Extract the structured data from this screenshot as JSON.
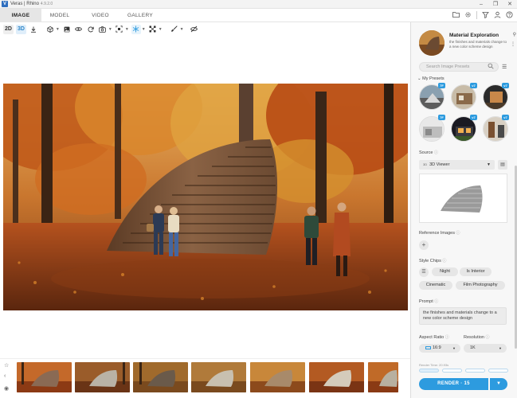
{
  "window": {
    "app_logo": "V",
    "title": "Veras | Rhino",
    "version": "4.9.2.0",
    "controls": [
      "–",
      "❐",
      "✕"
    ]
  },
  "nav": {
    "tabs": [
      {
        "label": "IMAGE",
        "active": true
      },
      {
        "label": "MODEL",
        "active": false
      },
      {
        "label": "VIDEO",
        "active": false
      },
      {
        "label": "GALLERY",
        "active": false
      }
    ],
    "icons": [
      "folder-icon",
      "gear-icon",
      "filter-icon",
      "user-icon",
      "help-icon"
    ]
  },
  "toolbar": {
    "mode_2d": "2D",
    "mode_3d": "3D",
    "icons": [
      "download-icon",
      "cube-icon",
      "image-icon",
      "eye-icon",
      "refresh-icon",
      "camera-icon",
      "selection-icon",
      "snowflake-icon",
      "transform-icon",
      "brush-icon",
      "hide-icon"
    ]
  },
  "panel": {
    "preset": {
      "title": "Material Exploration",
      "description": "the finishes and materials change to a new color scheme design"
    },
    "search": {
      "placeholder": "Search Image Presets"
    },
    "my_presets_label": "My Presets",
    "presets": [
      {
        "badge": "7F"
      },
      {
        "badge": "v7"
      },
      {
        "badge": "v7"
      },
      {
        "badge": "7F"
      },
      {
        "badge": "v7"
      },
      {
        "badge": "v7"
      }
    ],
    "source_label": "Source",
    "source_tag": "3D",
    "source_value": "3D Viewer",
    "reference_label": "Reference Images",
    "chips_label": "Style Chips",
    "chips": [
      "Night",
      "Is Interior",
      "Cinematic",
      "Film Photography"
    ],
    "prompt_label": "Prompt",
    "prompt_text": "the finishes and materials change to a new color scheme design",
    "aspect_label": "Aspect Ratio",
    "aspect_value": "16:9",
    "resolution_label": "Resolution",
    "resolution_value": "1K",
    "render_time": "Render Time: 20.93s",
    "render_button": "RENDER · 15",
    "render_progress": 0.25
  },
  "colors": {
    "accent": "#2d9bdf",
    "panel_bg": "#f7f7f7"
  }
}
